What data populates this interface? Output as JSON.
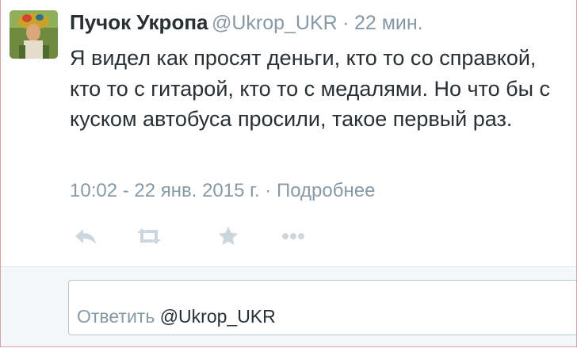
{
  "tweet": {
    "author_name": "Пучок Укропа",
    "screen_name": "@Ukrop_UKR",
    "separator": "·",
    "relative_time": "22 мин.",
    "text": "Я видел как просят деньги, кто то со справкой, кто то с гитарой, кто то с медалями. Но что бы с куском автобуса просили, такое первый раз.",
    "timestamp": "10:02 - 22 янв. 2015 г.",
    "meta_separator": " · ",
    "details_link": "Подробнее"
  },
  "actions": {
    "icons": [
      "reply-icon",
      "retweet-icon",
      "favorite-icon",
      "more-icon"
    ]
  },
  "reply": {
    "prefix": "Ответить ",
    "mention": "@Ukrop_UKR"
  },
  "colors": {
    "text": "#292f33",
    "muted": "#8899a6",
    "action_icon": "#ccd6dd",
    "reply_bg": "#f5f8fa",
    "frame_border": "#d9a3a3"
  }
}
